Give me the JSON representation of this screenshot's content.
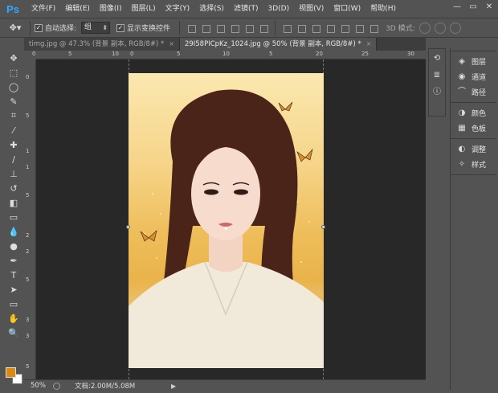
{
  "app": {
    "logo": "Ps"
  },
  "menu": [
    "文件(F)",
    "编辑(E)",
    "图像(I)",
    "图层(L)",
    "文字(Y)",
    "选择(S)",
    "滤镜(T)",
    "3D(D)",
    "视图(V)",
    "窗口(W)",
    "帮助(H)"
  ],
  "window_controls": {
    "minimize": "—",
    "restore": "▭",
    "close": "✕"
  },
  "options": {
    "auto_select_label": "自动选择:",
    "auto_select_checked": "✓",
    "auto_select_value": "组",
    "show_transform_label": "显示变换控件",
    "show_transform_checked": "✓",
    "mode_3d_label": "3D 模式:"
  },
  "tabs": [
    {
      "label": "timg.jpg @ 47.3% (背景 副本, RGB/8#) *",
      "close": "×"
    },
    {
      "label": "29I58PICpKz_1024.jpg @ 50% (背景 副本, RGB/8#) *",
      "close": "×"
    }
  ],
  "ruler_h": [
    "0",
    "5",
    "10",
    "0",
    "5",
    "10",
    "5",
    "20",
    "25",
    "30"
  ],
  "ruler_v": [
    "0",
    "5",
    "1",
    "1",
    "5",
    "2",
    "2",
    "5",
    "3",
    "3",
    "5"
  ],
  "colors": {
    "foreground": "#d98a13",
    "background": "#ffffff",
    "accent": "#31a8ff"
  },
  "status": {
    "zoom": "50%",
    "docinfo": "文档:2.00M/5.08M",
    "arrow": "▶"
  },
  "panels": [
    {
      "icon": "layers-icon",
      "label": "图层"
    },
    {
      "icon": "channels-icon",
      "label": "通道"
    },
    {
      "icon": "paths-icon",
      "label": "路径"
    },
    {
      "icon": "color-icon",
      "label": "颜色"
    },
    {
      "icon": "swatches-icon",
      "label": "色板"
    },
    {
      "icon": "adjustments-icon",
      "label": "调整"
    },
    {
      "icon": "styles-icon",
      "label": "样式"
    }
  ]
}
